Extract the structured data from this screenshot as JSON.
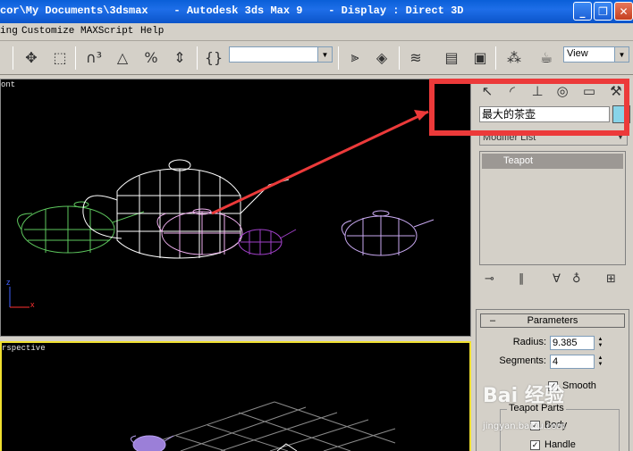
{
  "window": {
    "title": "cor\\My Documents\\3dsmax    - Autodesk 3ds Max 9    - Display : Direct 3D",
    "minimize": "_",
    "restore": "❐",
    "close": "✕"
  },
  "menu": [
    "ing",
    "Customize",
    "MAXScript",
    "Help"
  ],
  "toolbar": {
    "selection_set_value": "",
    "view_dropdown": "View"
  },
  "viewports": {
    "front_label": "ont",
    "perspective_label": "rspective",
    "axis_x": "x",
    "axis_z": "z"
  },
  "command_panel": {
    "object_name": "最大的茶壶",
    "object_color": "#88d4e8",
    "modifier_list": "Modifier List",
    "stack_item": "Teapot",
    "parameters": {
      "title": "Parameters",
      "radius_label": "Radius:",
      "radius_value": "9.385",
      "segments_label": "Segments:",
      "segments_value": "4",
      "smooth_label": "Smooth",
      "smooth_checked": true,
      "teapot_parts_label": "Teapot Parts",
      "body_label": "Body",
      "body_checked": true,
      "handle_label": "Handle",
      "handle_checked": true
    }
  },
  "watermark": {
    "brand": "Bai 经验",
    "url": "jingyan.baidu.com"
  },
  "annotation_color": "#ec3a3a"
}
